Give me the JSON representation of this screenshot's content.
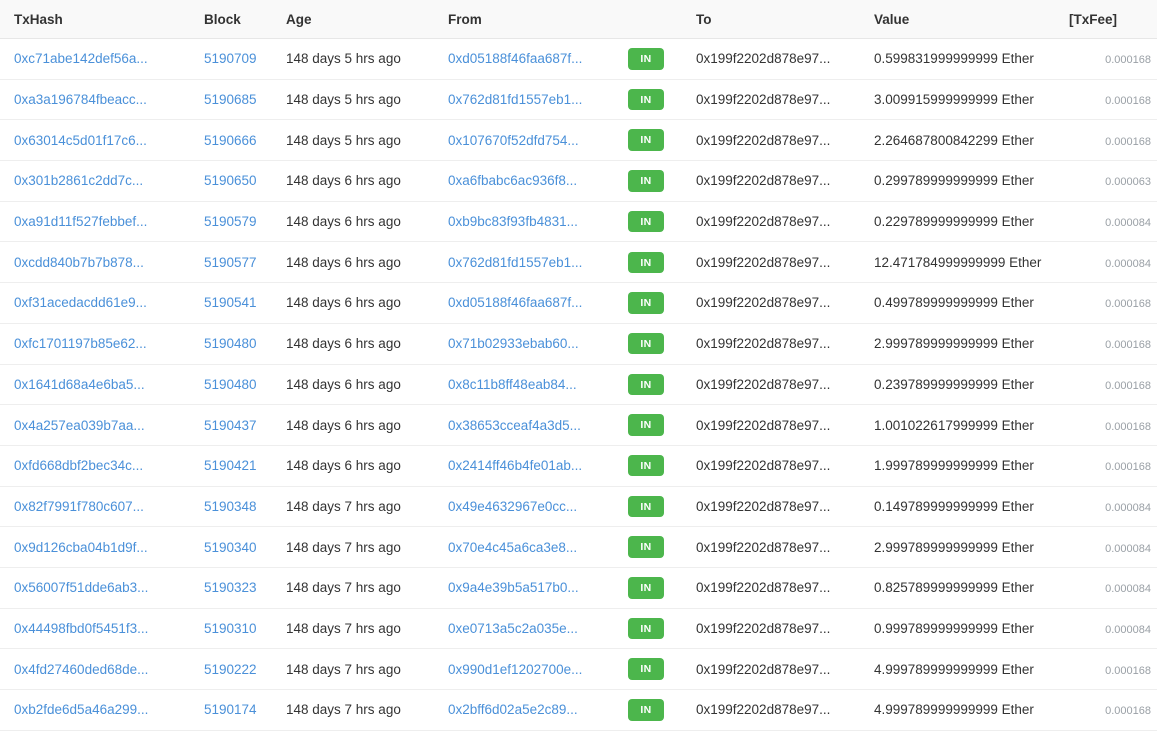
{
  "table": {
    "name": "ethereum-transactions-table",
    "columns": [
      {
        "key": "txhash",
        "label": "TxHash"
      },
      {
        "key": "block",
        "label": "Block"
      },
      {
        "key": "age",
        "label": "Age"
      },
      {
        "key": "from",
        "label": "From"
      },
      {
        "key": "direction",
        "label": ""
      },
      {
        "key": "to",
        "label": "To"
      },
      {
        "key": "value",
        "label": "Value"
      },
      {
        "key": "txfee",
        "label": "[TxFee]"
      }
    ],
    "colors": {
      "link": "#4a90d9",
      "badge_in_bg": "#4cb64c",
      "badge_in_text": "#ffffff",
      "header_bg": "#f9f9f9",
      "row_border": "#eeeeee",
      "text": "#333333",
      "txfee_text": "#9aa0a6",
      "txfee_header_text": "#c5c9cf"
    },
    "rows": [
      {
        "txhash": "0xc71abe142def56a...",
        "block": "5190709",
        "age": "148 days 5 hrs ago",
        "from": "0xd05188f46faa687f...",
        "direction": "IN",
        "to": "0x199f2202d878e97...",
        "value": "0.599831999999999 Ether",
        "txfee": "0.000168"
      },
      {
        "txhash": "0xa3a196784fbeacc...",
        "block": "5190685",
        "age": "148 days 5 hrs ago",
        "from": "0x762d81fd1557eb1...",
        "direction": "IN",
        "to": "0x199f2202d878e97...",
        "value": "3.009915999999999 Ether",
        "txfee": "0.000168"
      },
      {
        "txhash": "0x63014c5d01f17c6...",
        "block": "5190666",
        "age": "148 days 5 hrs ago",
        "from": "0x107670f52dfd754...",
        "direction": "IN",
        "to": "0x199f2202d878e97...",
        "value": "2.264687800842299 Ether",
        "txfee": "0.000168"
      },
      {
        "txhash": "0x301b2861c2dd7c...",
        "block": "5190650",
        "age": "148 days 6 hrs ago",
        "from": "0xa6fbabc6ac936f8...",
        "direction": "IN",
        "to": "0x199f2202d878e97...",
        "value": "0.299789999999999 Ether",
        "txfee": "0.000063"
      },
      {
        "txhash": "0xa91d11f527febbef...",
        "block": "5190579",
        "age": "148 days 6 hrs ago",
        "from": "0xb9bc83f93fb4831...",
        "direction": "IN",
        "to": "0x199f2202d878e97...",
        "value": "0.229789999999999 Ether",
        "txfee": "0.000084"
      },
      {
        "txhash": "0xcdd840b7b7b878...",
        "block": "5190577",
        "age": "148 days 6 hrs ago",
        "from": "0x762d81fd1557eb1...",
        "direction": "IN",
        "to": "0x199f2202d878e97...",
        "value": "12.471784999999999 Ether",
        "txfee": "0.000084"
      },
      {
        "txhash": "0xf31acedacdd61e9...",
        "block": "5190541",
        "age": "148 days 6 hrs ago",
        "from": "0xd05188f46faa687f...",
        "direction": "IN",
        "to": "0x199f2202d878e97...",
        "value": "0.499789999999999 Ether",
        "txfee": "0.000168"
      },
      {
        "txhash": "0xfc1701197b85e62...",
        "block": "5190480",
        "age": "148 days 6 hrs ago",
        "from": "0x71b02933ebab60...",
        "direction": "IN",
        "to": "0x199f2202d878e97...",
        "value": "2.999789999999999 Ether",
        "txfee": "0.000168"
      },
      {
        "txhash": "0x1641d68a4e6ba5...",
        "block": "5190480",
        "age": "148 days 6 hrs ago",
        "from": "0x8c11b8ff48eab84...",
        "direction": "IN",
        "to": "0x199f2202d878e97...",
        "value": "0.239789999999999 Ether",
        "txfee": "0.000168"
      },
      {
        "txhash": "0x4a257ea039b7aa...",
        "block": "5190437",
        "age": "148 days 6 hrs ago",
        "from": "0x38653cceaf4a3d5...",
        "direction": "IN",
        "to": "0x199f2202d878e97...",
        "value": "1.001022617999999 Ether",
        "txfee": "0.000168"
      },
      {
        "txhash": "0xfd668dbf2bec34c...",
        "block": "5190421",
        "age": "148 days 6 hrs ago",
        "from": "0x2414ff46b4fe01ab...",
        "direction": "IN",
        "to": "0x199f2202d878e97...",
        "value": "1.999789999999999 Ether",
        "txfee": "0.000168"
      },
      {
        "txhash": "0x82f7991f780c607...",
        "block": "5190348",
        "age": "148 days 7 hrs ago",
        "from": "0x49e4632967e0cc...",
        "direction": "IN",
        "to": "0x199f2202d878e97...",
        "value": "0.149789999999999 Ether",
        "txfee": "0.000084"
      },
      {
        "txhash": "0x9d126cba04b1d9f...",
        "block": "5190340",
        "age": "148 days 7 hrs ago",
        "from": "0x70e4c45a6ca3e8...",
        "direction": "IN",
        "to": "0x199f2202d878e97...",
        "value": "2.999789999999999 Ether",
        "txfee": "0.000084"
      },
      {
        "txhash": "0x56007f51dde6ab3...",
        "block": "5190323",
        "age": "148 days 7 hrs ago",
        "from": "0x9a4e39b5a517b0...",
        "direction": "IN",
        "to": "0x199f2202d878e97...",
        "value": "0.825789999999999 Ether",
        "txfee": "0.000084"
      },
      {
        "txhash": "0x44498fbd0f5451f3...",
        "block": "5190310",
        "age": "148 days 7 hrs ago",
        "from": "0xe0713a5c2a035e...",
        "direction": "IN",
        "to": "0x199f2202d878e97...",
        "value": "0.999789999999999 Ether",
        "txfee": "0.000084"
      },
      {
        "txhash": "0x4fd27460ded68de...",
        "block": "5190222",
        "age": "148 days 7 hrs ago",
        "from": "0x990d1ef1202700e...",
        "direction": "IN",
        "to": "0x199f2202d878e97...",
        "value": "4.999789999999999 Ether",
        "txfee": "0.000168"
      },
      {
        "txhash": "0xb2fde6d5a46a299...",
        "block": "5190174",
        "age": "148 days 7 hrs ago",
        "from": "0x2bff6d02a5e2c89...",
        "direction": "IN",
        "to": "0x199f2202d878e97...",
        "value": "4.999789999999999 Ether",
        "txfee": "0.000168"
      }
    ]
  }
}
